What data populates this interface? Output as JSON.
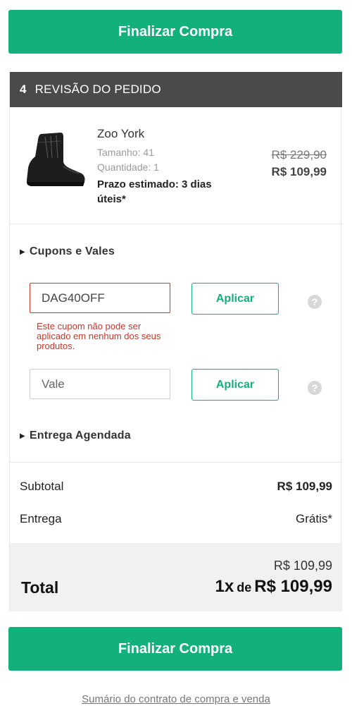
{
  "buttons": {
    "checkout_label": "Finalizar Compra"
  },
  "review": {
    "step_number": "4",
    "title": "REVISÃO DO PEDIDO"
  },
  "product": {
    "name": "Zoo York",
    "size": "Tamanho: 41",
    "quantity": "Quantidade: 1",
    "deadline": "Prazo estimado: 3 dias úteis*",
    "price_old": "R$ 229,90",
    "price_new": "R$ 109,99"
  },
  "coupons": {
    "toggle_label": "Cupons e Vales",
    "coupon_value": "DAG40OFF",
    "coupon_error": "Este cupom não pode ser aplicado em nenhum dos seus produtos.",
    "apply_label": "Aplicar",
    "vale_placeholder": "Vale"
  },
  "scheduled_delivery": {
    "toggle_label": "Entrega Agendada"
  },
  "summary": {
    "subtotal_label": "Subtotal",
    "subtotal_value": "R$ 109,99",
    "delivery_label": "Entrega",
    "delivery_value": "Grátis*",
    "total_label": "Total",
    "total_small": "R$ 109,99",
    "installments": "1x",
    "installments_de": "de",
    "installment_value": "R$ 109,99"
  },
  "footer": {
    "contract_link": "Sumário do contrato de compra e venda"
  },
  "colors": {
    "accent": "#12b07a",
    "header_bg": "#4a4a4a",
    "error": "#c0392b"
  }
}
